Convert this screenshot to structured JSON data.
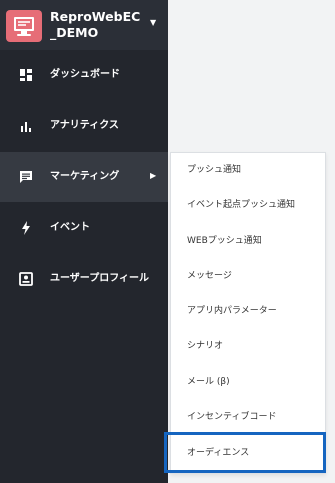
{
  "app": {
    "title": "ReproWebEC_DEMO",
    "logo_icon": "monitor-icon",
    "caret_icon": "caret-down-icon"
  },
  "nav": {
    "items": [
      {
        "label": "ダッシュボード",
        "icon": "dashboard-icon"
      },
      {
        "label": "アナリティクス",
        "icon": "bar-chart-icon"
      },
      {
        "label": "マーケティング",
        "icon": "message-icon",
        "active": true,
        "has_submenu": true
      },
      {
        "label": "イベント",
        "icon": "lightning-icon"
      },
      {
        "label": "ユーザープロフィール",
        "icon": "profile-icon"
      }
    ]
  },
  "submenu": {
    "items": [
      {
        "label": "プッシュ通知"
      },
      {
        "label": "イベント起点プッシュ通知"
      },
      {
        "label": "WEBプッシュ通知"
      },
      {
        "label": "メッセージ"
      },
      {
        "label": "アプリ内パラメーター"
      },
      {
        "label": "シナリオ"
      },
      {
        "label": "メール (β)"
      },
      {
        "label": "インセンティブコード"
      },
      {
        "label": "オーディエンス",
        "highlighted": true
      }
    ]
  },
  "colors": {
    "sidebar_bg": "#23262d",
    "header_bg": "#2b2f37",
    "active_bg": "#363a42",
    "logo_bg": "#e66d77",
    "highlight_border": "#1565c0"
  }
}
